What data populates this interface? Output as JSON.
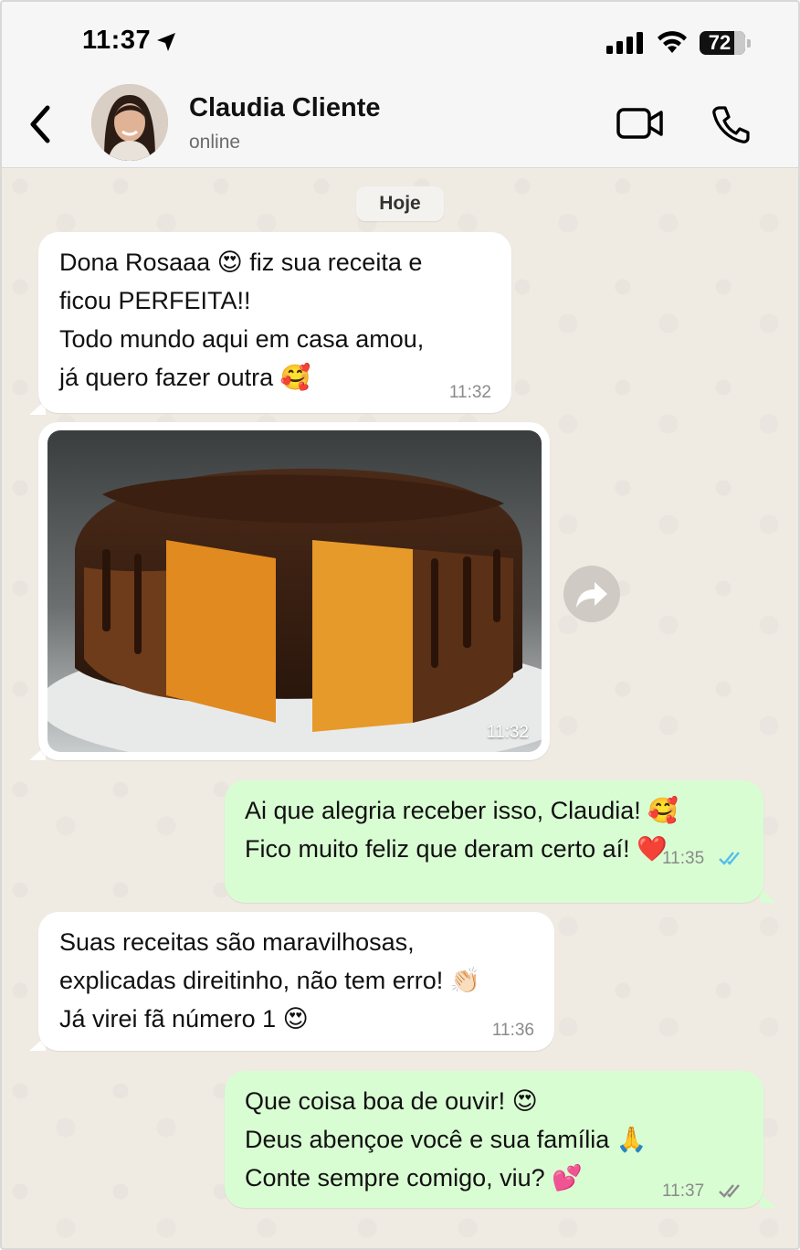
{
  "status_bar": {
    "time": "11:37",
    "battery": "72",
    "icons": [
      "location-arrow-icon",
      "signal-bars-icon",
      "wifi-icon",
      "battery-icon"
    ]
  },
  "header": {
    "contact_name": "Claudia Cliente",
    "contact_status": "online",
    "icons": [
      "back-chevron-icon",
      "video-call-icon",
      "phone-icon"
    ]
  },
  "chat": {
    "day_label": "Hoje",
    "messages": [
      {
        "direction": "incoming",
        "text": "Dona Rosaaa 😍 fiz sua receita e\nficou PERFEITA!!\nTodo mundo aqui em casa amou,\njá quero fazer outra 🥰",
        "time": "11:32"
      },
      {
        "direction": "incoming",
        "type": "image",
        "image_subject": "bolo de cenoura com cobertura de chocolate",
        "time": "11:32"
      },
      {
        "direction": "outgoing",
        "text": "Ai que alegria receber isso, Claudia! 🥰\nFico muito feliz que deram certo aí! ❤️",
        "time": "11:35",
        "status": "read"
      },
      {
        "direction": "incoming",
        "text": "Suas receitas são maravilhosas,\nexplicadas direitinho, não tem erro! 👏🏻\nJá virei fã número 1 😍",
        "time": "11:36"
      },
      {
        "direction": "outgoing",
        "text": "Que coisa boa de ouvir! 😍\nDeus abençoe você e sua família 🙏\nConte sempre comigo, viu? 💕",
        "time": "11:37",
        "status": "delivered"
      }
    ]
  },
  "colors": {
    "incoming_bubble": "#ffffff",
    "outgoing_bubble": "#d9fdd3",
    "chat_background": "#efeae2",
    "read_ticks": "#53bdeb",
    "delivered_ticks": "#8a8a8a"
  }
}
